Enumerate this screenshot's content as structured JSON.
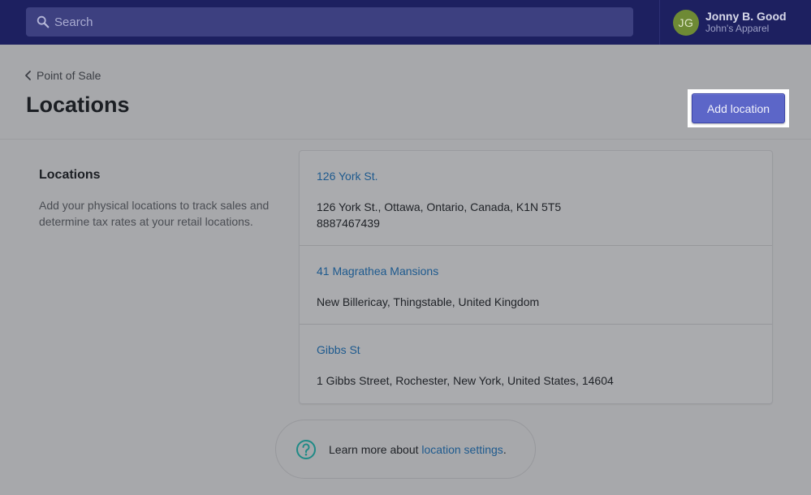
{
  "search": {
    "placeholder": "Search"
  },
  "user": {
    "initials": "JG",
    "name": "Jonny B. Good",
    "store": "John's Apparel"
  },
  "header": {
    "breadcrumb": "Point of Sale",
    "title": "Locations",
    "add_button": "Add location"
  },
  "annotation": {
    "title": "Locations",
    "description": "Add your physical locations to track sales and determine tax rates at your retail locations."
  },
  "locations": [
    {
      "name": "126 York St.",
      "address": "126 York St., Ottawa, Ontario, Canada, K1N 5T5",
      "phone": "8887467439"
    },
    {
      "name": "41 Magrathea Mansions",
      "address": "New Billericay, Thingstable, United Kingdom"
    },
    {
      "name": "Gibbs St",
      "address": "1 Gibbs Street, Rochester, New York, United States, 14604"
    }
  ],
  "help": {
    "text": "Learn more about ",
    "link": "location settings",
    "suffix": "."
  },
  "colors": {
    "topbar": "#1d2060",
    "primary_button": "#5c66c8",
    "link": "#1e5a8e",
    "avatar": "#6e8a35",
    "help_icon": "#1f8a86"
  },
  "icons": [
    "search-icon",
    "chevron-left-icon",
    "help-circle-icon"
  ]
}
